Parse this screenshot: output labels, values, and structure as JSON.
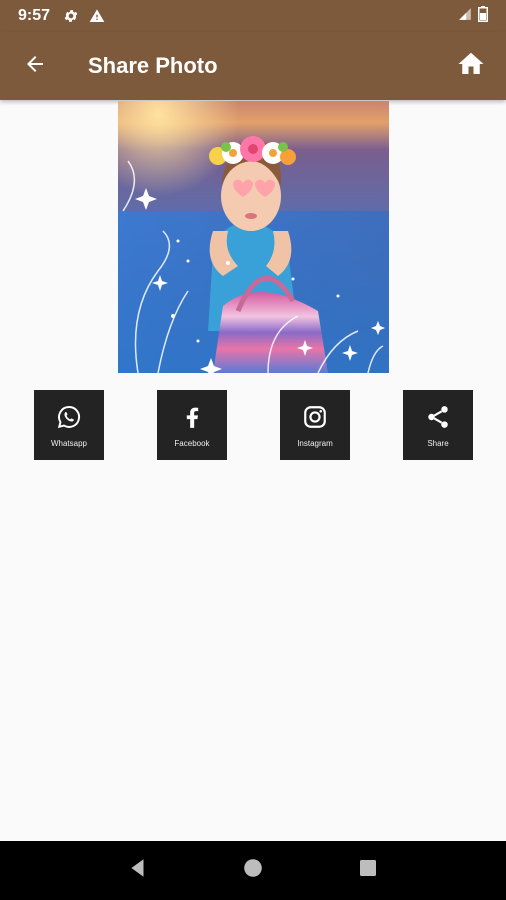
{
  "status_bar": {
    "time": "9:57",
    "icons": [
      "settings-icon",
      "warning-icon",
      "signal-icon",
      "battery-icon"
    ]
  },
  "app_bar": {
    "title": "Share Photo",
    "back_icon": "arrow-back-icon",
    "home_icon": "home-icon",
    "color": "#7d5a3b"
  },
  "photo": {
    "description_icon": "edited-photo"
  },
  "share_buttons": [
    {
      "label": "Whatsapp",
      "icon": "whatsapp-icon"
    },
    {
      "label": "Facebook",
      "icon": "facebook-icon"
    },
    {
      "label": "Instagram",
      "icon": "instagram-icon"
    },
    {
      "label": "Share",
      "icon": "share-icon"
    }
  ],
  "nav_bar": {
    "buttons": [
      "back-triangle-icon",
      "home-circle-icon",
      "recents-square-icon"
    ]
  }
}
